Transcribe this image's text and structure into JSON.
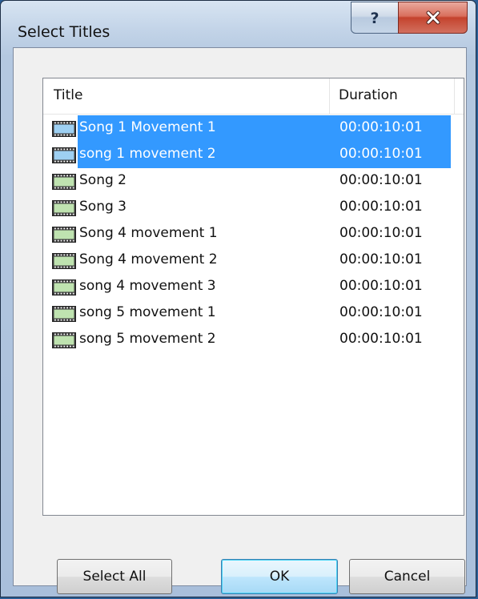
{
  "window": {
    "title": "Select Titles",
    "help_label": "?",
    "close_label": "x"
  },
  "list": {
    "columns": {
      "title": "Title",
      "duration": "Duration"
    },
    "rows": [
      {
        "name": "Song 1 Movement 1",
        "duration": "00:00:10:01",
        "selected": true
      },
      {
        "name": "song 1 movement 2",
        "duration": "00:00:10:01",
        "selected": true
      },
      {
        "name": "Song 2",
        "duration": "00:00:10:01",
        "selected": false
      },
      {
        "name": "Song 3",
        "duration": "00:00:10:01",
        "selected": false
      },
      {
        "name": "Song 4 movement 1",
        "duration": "00:00:10:01",
        "selected": false
      },
      {
        "name": "Song 4 movement 2",
        "duration": "00:00:10:01",
        "selected": false
      },
      {
        "name": "song 4 movement 3",
        "duration": "00:00:10:01",
        "selected": false
      },
      {
        "name": "song 5 movement 1",
        "duration": "00:00:10:01",
        "selected": false
      },
      {
        "name": "song 5 movement 2",
        "duration": "00:00:10:01",
        "selected": false
      }
    ],
    "row_icon": "film-strip-icon"
  },
  "buttons": {
    "select_all": "Select All",
    "ok": "OK",
    "cancel": "Cancel"
  },
  "colors": {
    "selection": "#3399ff",
    "close_button": "#c4432d"
  }
}
